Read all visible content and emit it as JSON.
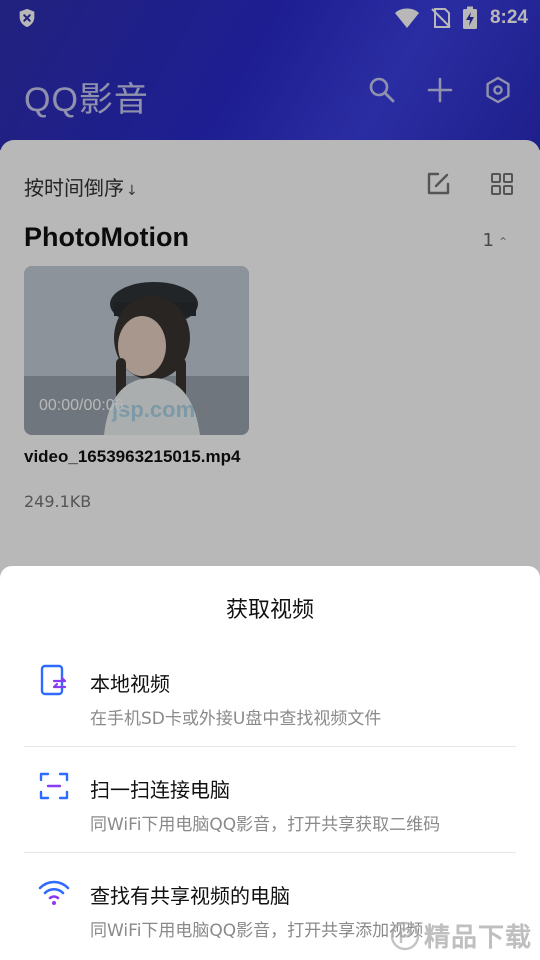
{
  "status_bar": {
    "time": "8:24"
  },
  "header": {
    "app_title": "QQ影音",
    "actions": [
      "search-icon",
      "plus-icon",
      "settings-icon"
    ]
  },
  "toolbar": {
    "sort_label": "按时间倒序",
    "sort_indicator": "↓"
  },
  "section": {
    "title": "PhotoMotion",
    "count": "1",
    "count_indicator": "⌃"
  },
  "video": {
    "duration": "00:00/00:06",
    "watermark": "jsp.com",
    "name": "video_1653963215015.mp4",
    "size": "249.1KB"
  },
  "sheet": {
    "title": "获取视频",
    "options": [
      {
        "title": "本地视频",
        "subtitle": "在手机SD卡或外接U盘中查找视频文件",
        "icon": "local-video-icon"
      },
      {
        "title": "扫一扫连接电脑",
        "subtitle": "同WiFi下用电脑QQ影音，打开共享获取二维码",
        "icon": "scan-icon"
      },
      {
        "title": "查找有共享视频的电脑",
        "subtitle": "同WiFi下用电脑QQ影音，打开共享添加视频",
        "icon": "wifi-icon"
      }
    ]
  },
  "watermark": {
    "text": "精品下载"
  },
  "colors": {
    "header_gradient_start": "#2f2fb0",
    "header_gradient_end": "#3b3fe0",
    "accent_blue": "#2f6bff",
    "accent_purple": "#8a3cf2"
  }
}
